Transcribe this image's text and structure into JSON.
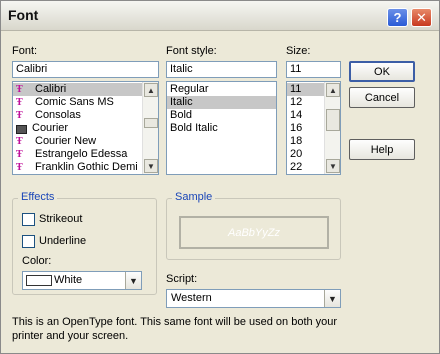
{
  "window": {
    "title": "Font"
  },
  "titlebar": {
    "help_glyph": "?",
    "close_glyph": "✕"
  },
  "font": {
    "label": "Font:",
    "value": "Calibri",
    "items": [
      {
        "name": "Calibri",
        "icon": "truetype-icon",
        "selected": true
      },
      {
        "name": "Comic Sans MS",
        "icon": "truetype-icon"
      },
      {
        "name": "Consolas",
        "icon": "truetype-icon"
      },
      {
        "name": "Courier",
        "icon": "printer-font-icon"
      },
      {
        "name": "Courier New",
        "icon": "truetype-icon"
      },
      {
        "name": "Estrangelo Edessa",
        "icon": "truetype-icon"
      },
      {
        "name": "Franklin Gothic Demi",
        "icon": "truetype-icon"
      }
    ]
  },
  "style": {
    "label": "Font style:",
    "value": "Italic",
    "items": [
      "Regular",
      "Italic",
      "Bold",
      "Bold Italic"
    ]
  },
  "size": {
    "label": "Size:",
    "value": "11",
    "items": [
      "11",
      "12",
      "14",
      "16",
      "18",
      "20",
      "22"
    ]
  },
  "buttons": {
    "ok": "OK",
    "cancel": "Cancel",
    "help": "Help"
  },
  "effects": {
    "title": "Effects",
    "strikeout": "Strikeout",
    "underline": "Underline",
    "color_label": "Color:",
    "color_value": "White",
    "color_swatch": "#ffffff"
  },
  "sample": {
    "title": "Sample",
    "text": "AaBbYyZz"
  },
  "script": {
    "label": "Script:",
    "value": "Western"
  },
  "info": "This is an OpenType font. This same font will be used on both your printer and your screen.",
  "colors": {
    "selection": "#c7c7c7",
    "group_title": "#1a46b8",
    "truetype_icon": "#c0119a"
  }
}
